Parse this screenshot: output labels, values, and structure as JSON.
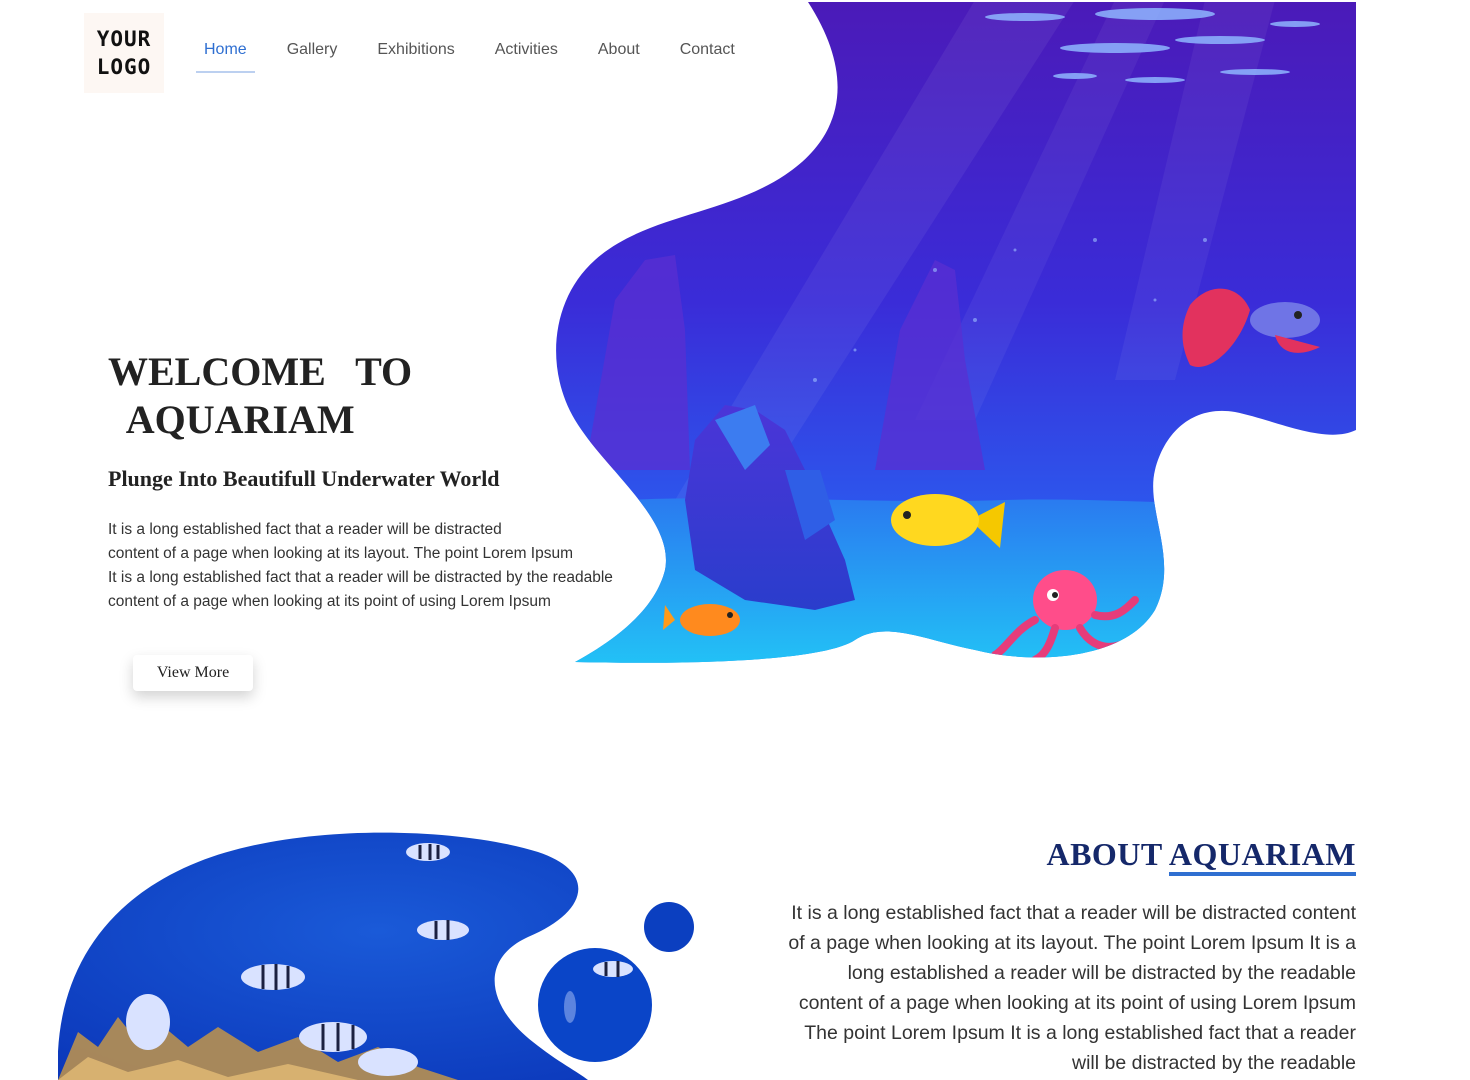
{
  "logo": {
    "line1": "YOUR",
    "line2": "LOGO"
  },
  "nav": {
    "items": [
      {
        "label": "Home",
        "active": true
      },
      {
        "label": "Gallery"
      },
      {
        "label": "Exhibitions"
      },
      {
        "label": "Activities"
      },
      {
        "label": "About"
      },
      {
        "label": "Contact"
      }
    ]
  },
  "hero": {
    "title": "WELCOME   TO\n  AQUARIAM",
    "subtitle": "Plunge Into Beautifull Underwater World",
    "paragraph_lines": [
      "It is a long established fact that a reader will be distracted",
      "content of a page when looking at its layout. The point Lorem Ipsum",
      "It is a long established fact that a reader will be distracted by the readable",
      "content of a page when looking at its point of using Lorem Ipsum"
    ],
    "button_label": "View More"
  },
  "about": {
    "title_prefix": "ABOUT",
    "title_highlight": "AQUARIAM",
    "paragraph_lines": [
      "It is a long established fact that a reader will be distracted content",
      "of a page when looking at its layout. The point Lorem Ipsum It is a",
      "long established a reader will be distracted by the readable",
      "content of a page when looking at its point of using Lorem Ipsum",
      "The point Lorem Ipsum It is a long established fact that a reader",
      "will be distracted by the readable"
    ]
  },
  "colors": {
    "accent": "#2f6fd1",
    "title_navy": "#15286a",
    "ocean_deep": "#3a1fc4",
    "ocean_light": "#1ea8f0"
  }
}
